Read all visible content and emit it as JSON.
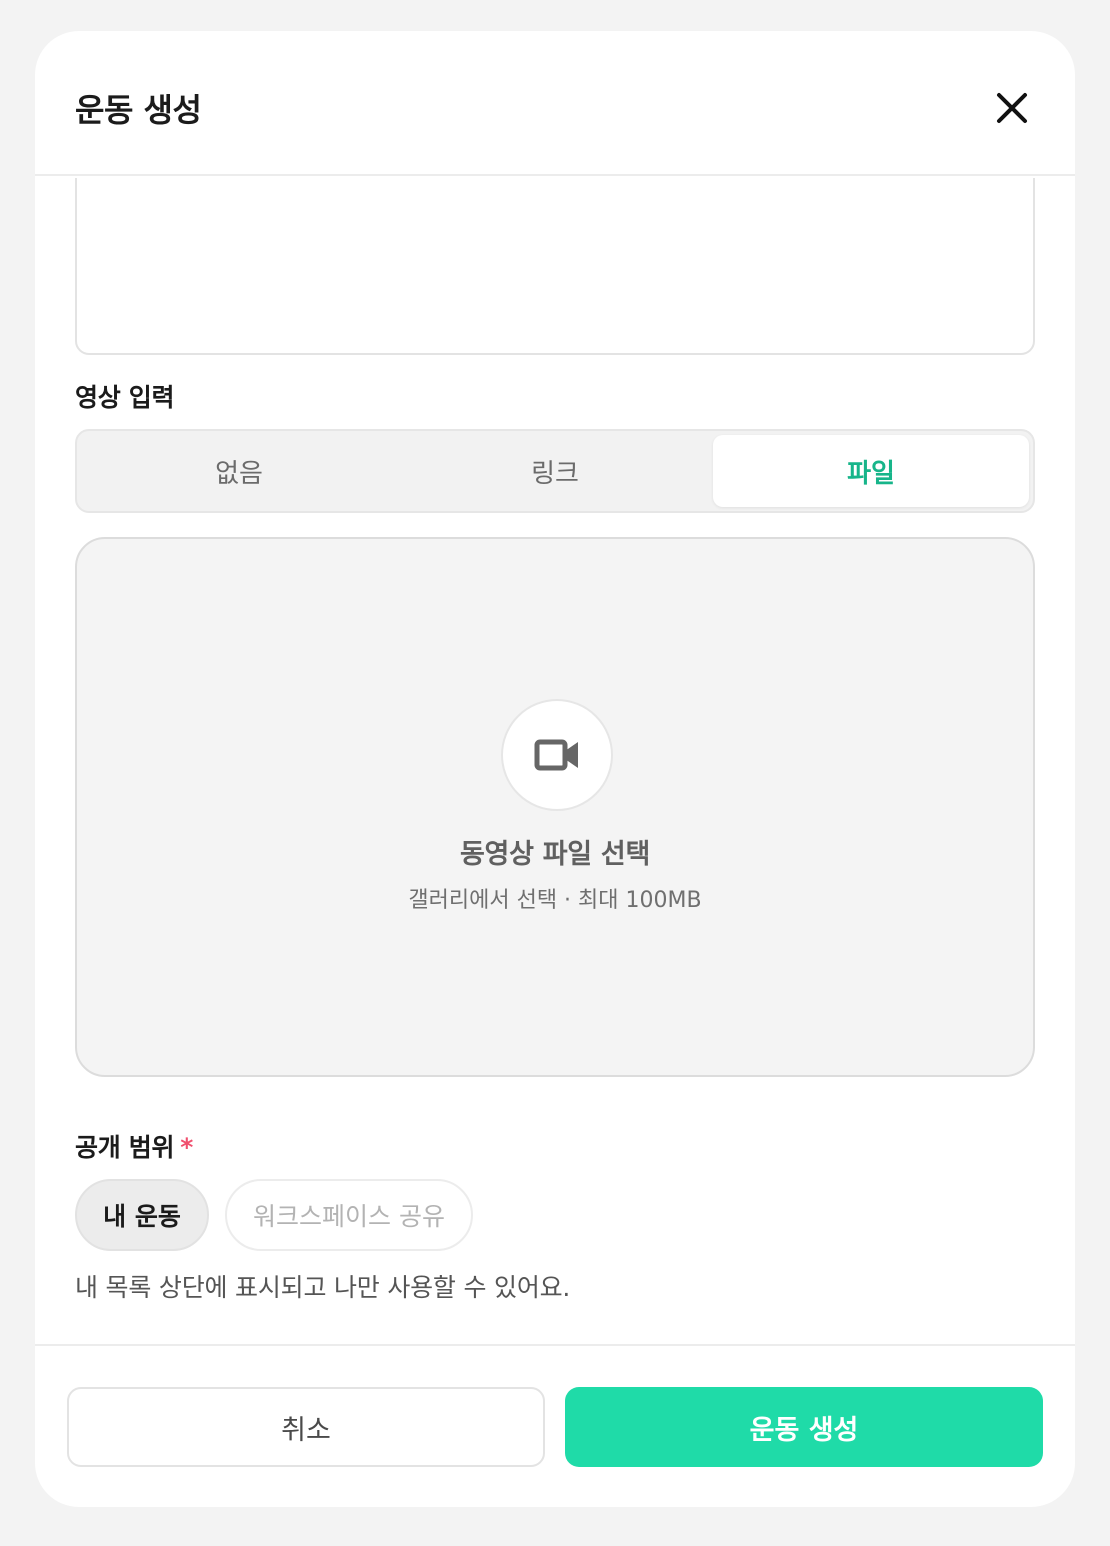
{
  "modal": {
    "title": "운동 생성",
    "close_icon": "close-icon"
  },
  "video_input": {
    "label": "영상 입력",
    "options": [
      {
        "label": "없음",
        "active": false
      },
      {
        "label": "링크",
        "active": false
      },
      {
        "label": "파일",
        "active": true
      }
    ],
    "dropzone": {
      "icon": "video-camera-icon",
      "title": "동영상 파일 선택",
      "subtitle": "갤러리에서 선택 · 최대 100MB"
    }
  },
  "visibility": {
    "label": "공개 범위",
    "required_mark": "*",
    "options": [
      {
        "label": "내 운동",
        "selected": true
      },
      {
        "label": "워크스페이스 공유",
        "selected": false
      }
    ],
    "description": "내 목록 상단에 표시되고 나만 사용할 수 있어요."
  },
  "footer": {
    "cancel_label": "취소",
    "submit_label": "운동 생성"
  },
  "colors": {
    "accent": "#1fdba8",
    "accent_text": "#17b58a",
    "required": "#f0506e"
  }
}
